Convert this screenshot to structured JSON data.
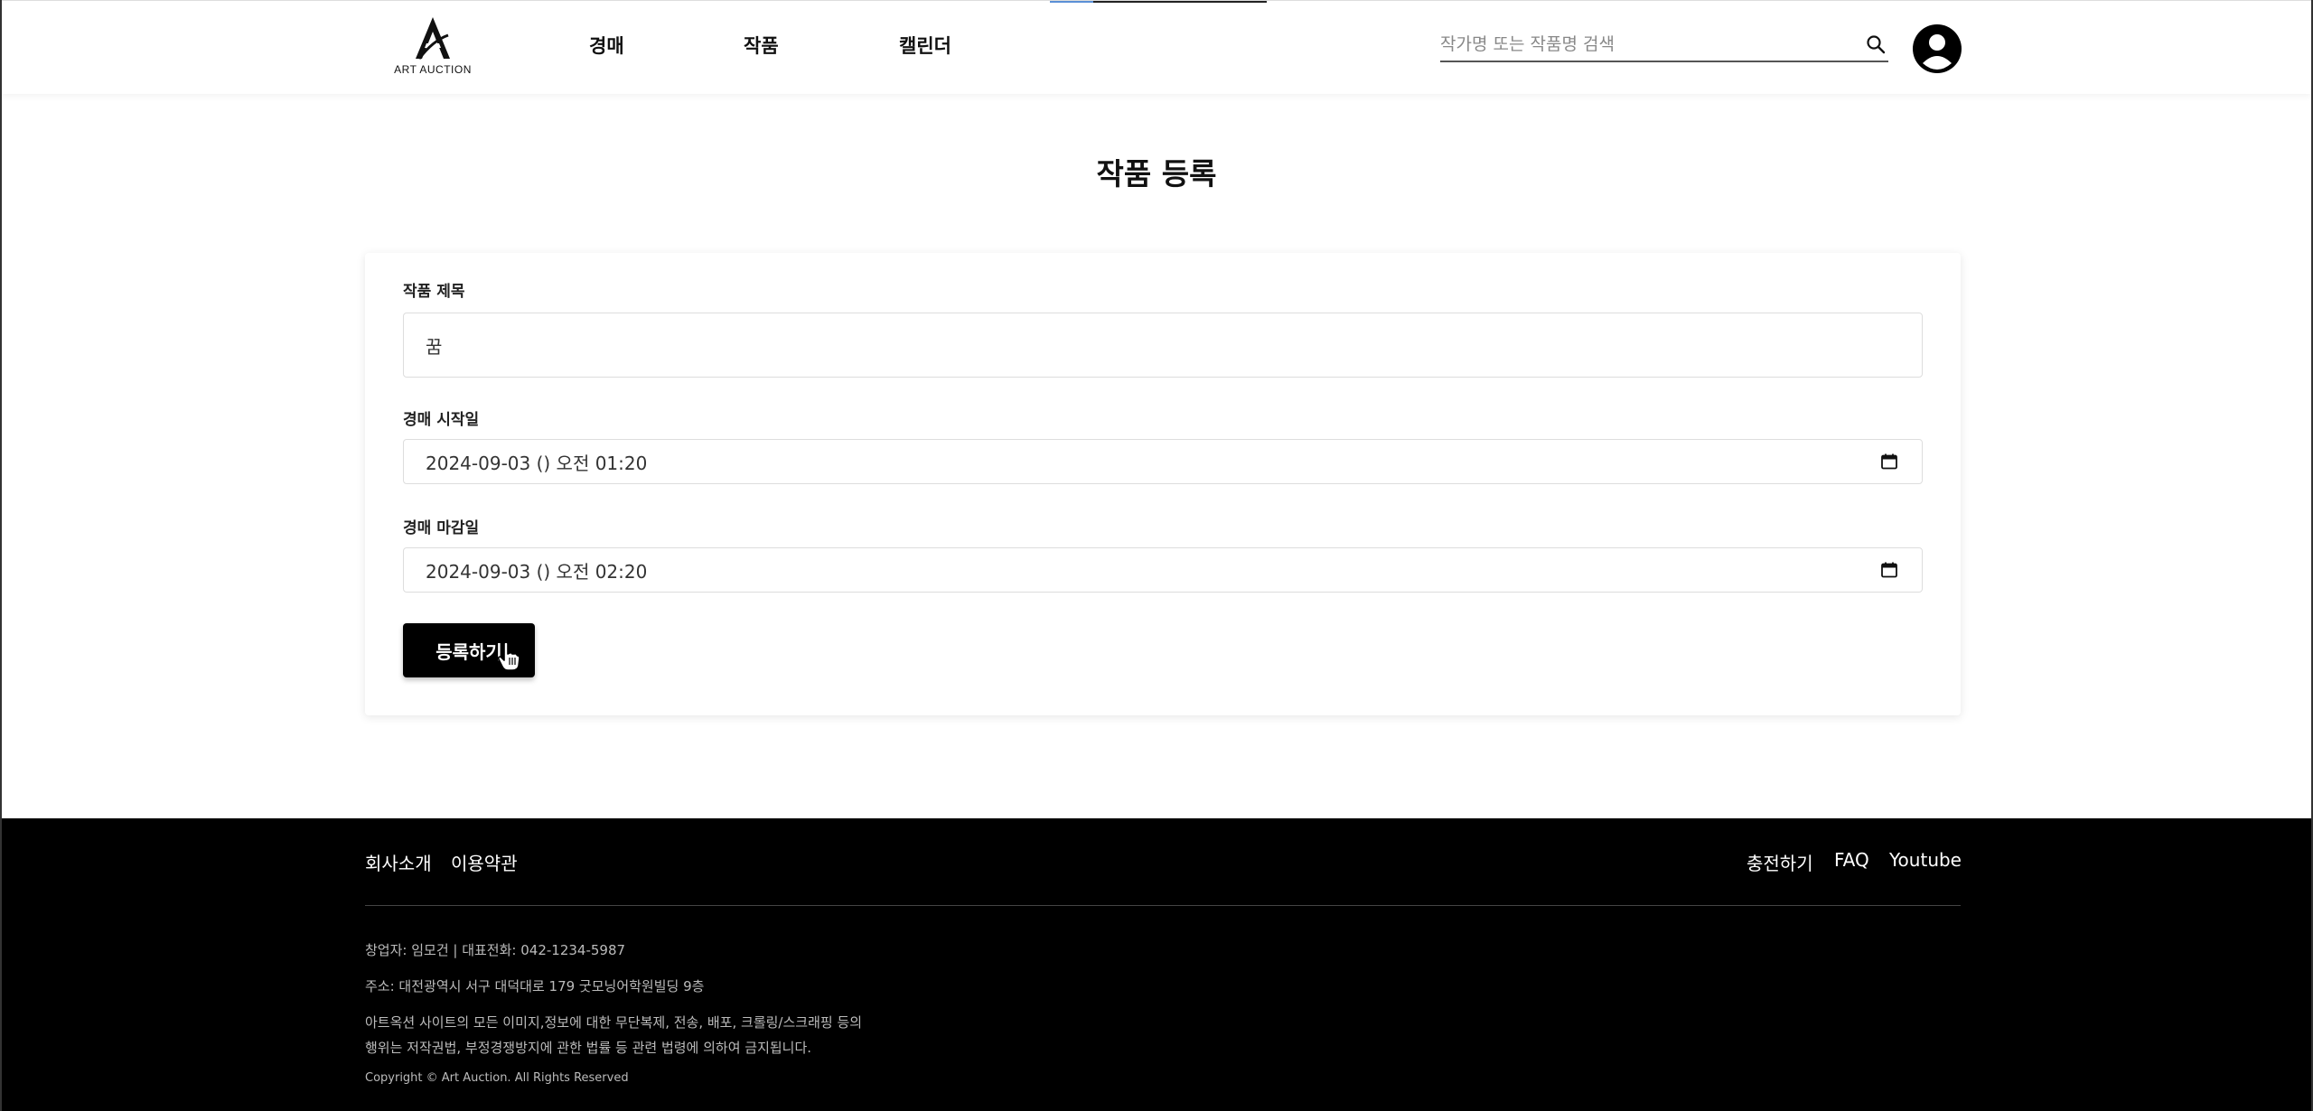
{
  "header": {
    "logo_text": "ART AUCTION",
    "nav": [
      "경매",
      "작품",
      "캘린더"
    ],
    "search_placeholder": "작가명 또는 작품명 검색"
  },
  "main": {
    "title": "작품 등록",
    "fields": {
      "title_label": "작품 제목",
      "title_value": "꿈",
      "start_label": "경매 시작일",
      "start_value": "2024-09-03 () 오전 01:20",
      "end_label": "경매 마감일",
      "end_value": "2024-09-03 () 오전 02:20"
    },
    "submit_label": "등록하기"
  },
  "footer": {
    "left_links": [
      "회사소개",
      "이용약관"
    ],
    "right_links": [
      "충전하기",
      "FAQ",
      "Youtube"
    ],
    "info": {
      "founder": "창업자: 임모건 | 대표전화: 042-1234-5987",
      "address": "주소: 대전광역시 서구 대덕대로 179 굿모닝어학원빌딩 9층",
      "notice_line1": "아트옥션 사이트의 모든 이미지,정보에 대한 무단복제, 전송, 배포, 크롤링/스크래핑 등의",
      "notice_line2": "행위는 저작권법, 부정경쟁방지에 관한 법률 등 관련 법령에 의하여 금지됩니다.",
      "copyright": "Copyright © Art Auction. All Rights Reserved"
    }
  },
  "colors": {
    "accent": "#000000",
    "footer_bg": "#000000"
  }
}
